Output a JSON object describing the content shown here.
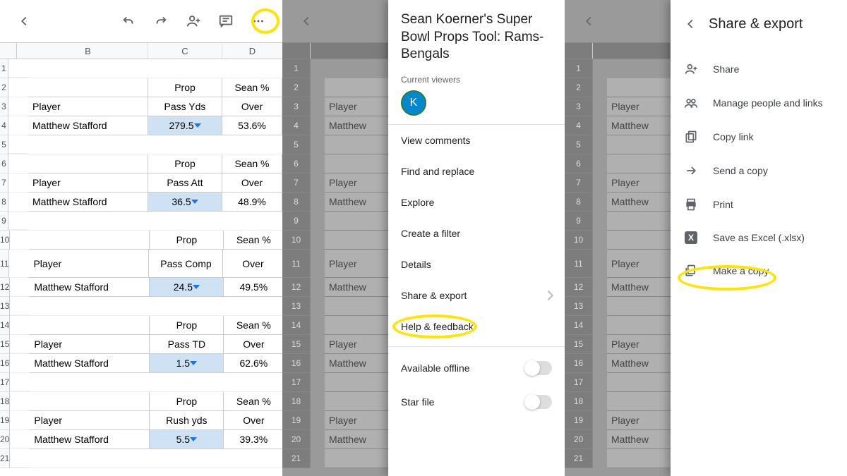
{
  "cols": {
    "B": "B",
    "C": "C",
    "D": "D"
  },
  "rows": [
    "1",
    "2",
    "3",
    "4",
    "5",
    "6",
    "7",
    "8",
    "9",
    "10",
    "11",
    "12",
    "13",
    "14",
    "15",
    "16",
    "17",
    "18",
    "19",
    "20",
    "21"
  ],
  "blocks": [
    {
      "propLabel": "Prop",
      "seanLabel": "Sean %",
      "playerLabel": "Player",
      "stat": "Pass Yds",
      "overLabel": "Over",
      "name": "Matthew Stafford",
      "line": "279.5",
      "pct": "53.6%"
    },
    {
      "propLabel": "Prop",
      "seanLabel": "Sean %",
      "playerLabel": "Player",
      "stat": "Pass Att",
      "overLabel": "Over",
      "name": "Matthew Stafford",
      "line": "36.5",
      "pct": "48.9%"
    },
    {
      "propLabel": "Prop",
      "seanLabel": "Sean %",
      "playerLabel": "Player",
      "stat": "Pass Comp",
      "overLabel": "Over",
      "name": "Matthew Stafford",
      "line": "24.5",
      "pct": "49.5%"
    },
    {
      "propLabel": "Prop",
      "seanLabel": "Sean %",
      "playerLabel": "Player",
      "stat": "Pass TD",
      "overLabel": "Over",
      "name": "Matthew Stafford",
      "line": "1.5",
      "pct": "62.6%"
    },
    {
      "propLabel": "Prop",
      "seanLabel": "Sean %",
      "playerLabel": "Player",
      "stat": "Rush yds",
      "overLabel": "Over",
      "name": "Matthew Stafford",
      "line": "5.5",
      "pct": "39.3%"
    }
  ],
  "dimRows": [
    {
      "n": "2",
      "b": ""
    },
    {
      "n": "3",
      "b": "Player"
    },
    {
      "n": "4",
      "b": "Matthew"
    },
    {
      "n": "5",
      "b": ""
    },
    {
      "n": "6",
      "b": ""
    },
    {
      "n": "7",
      "b": "Player"
    },
    {
      "n": "8",
      "b": "Matthew"
    },
    {
      "n": "9",
      "b": ""
    },
    {
      "n": "10",
      "b": ""
    },
    {
      "n": "11",
      "b": "Player"
    },
    {
      "n": "12",
      "b": "Matthew"
    },
    {
      "n": "13",
      "b": ""
    },
    {
      "n": "14",
      "b": ""
    },
    {
      "n": "15",
      "b": "Player"
    },
    {
      "n": "16",
      "b": "Matthew"
    },
    {
      "n": "17",
      "b": ""
    },
    {
      "n": "18",
      "b": ""
    },
    {
      "n": "19",
      "b": "Player"
    },
    {
      "n": "20",
      "b": "Matthew"
    },
    {
      "n": "21",
      "b": ""
    }
  ],
  "sheet": {
    "title": "Sean Koerner's Super Bowl Props Tool: Rams-Bengals",
    "currentViewers": "Current viewers",
    "avatar": "K",
    "viewComments": "View comments",
    "findReplace": "Find and replace",
    "explore": "Explore",
    "createFilter": "Create a filter",
    "details": "Details",
    "shareExport": "Share & export",
    "helpFeedback": "Help & feedback",
    "availableOffline": "Available offline",
    "starFile": "Star file"
  },
  "share": {
    "title": "Share & export",
    "share": "Share",
    "manage": "Manage people and links",
    "copyLink": "Copy link",
    "sendCopy": "Send a copy",
    "print": "Print",
    "saveExcel": "Save as Excel (.xlsx)",
    "makeCopy": "Make a copy",
    "xlabel": "X"
  }
}
